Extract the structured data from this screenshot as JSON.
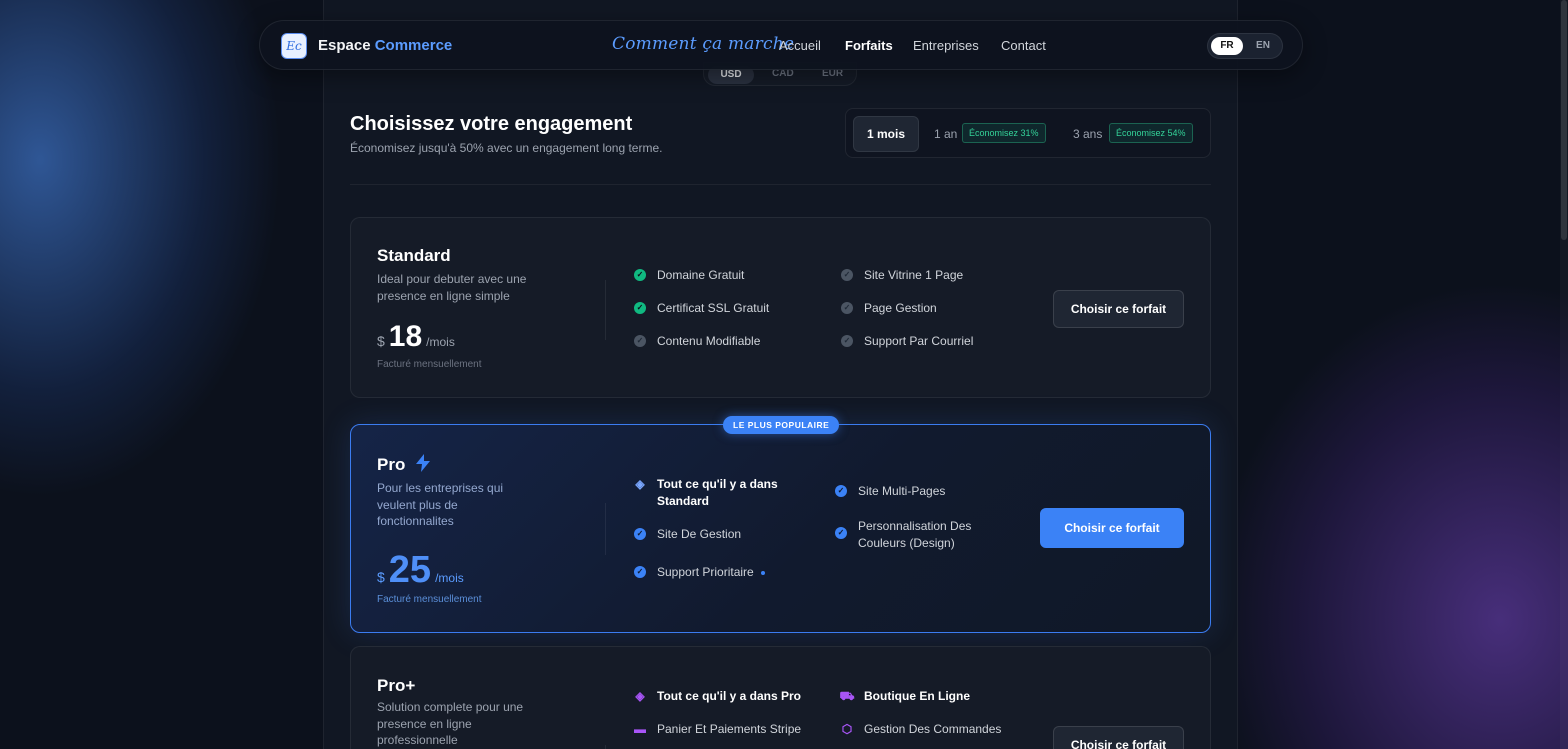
{
  "navbar": {
    "logo_text": "Ec",
    "brand_primary": "Espace",
    "brand_accent": "Commerce",
    "how_it_works": "Comment ça marche",
    "links": [
      "Accueil",
      "Forfaits",
      "Entreprises",
      "Contact"
    ],
    "active_link": "Forfaits",
    "lang": {
      "fr": "FR",
      "en": "EN",
      "selected": "FR"
    }
  },
  "currency": {
    "options": [
      "USD",
      "CAD",
      "EUR"
    ],
    "selected": "USD"
  },
  "commitment": {
    "title": "Choisissez votre engagement",
    "subtitle": "Économisez jusqu'à 50% avec un engagement long terme.",
    "options": [
      {
        "label": "1 mois",
        "save": ""
      },
      {
        "label": "1 an",
        "save": "Économisez 31%"
      },
      {
        "label": "3 ans",
        "save": "Économisez 54%"
      }
    ],
    "selected": "1 mois"
  },
  "plans": [
    {
      "name": "Standard",
      "desc": "Ideal pour debuter avec une presence en ligne simple",
      "currency": "$",
      "price": "18",
      "period": "/mois",
      "billed": "Facturé mensuellement",
      "features_left": [
        "Domaine Gratuit",
        "Certificat SSL Gratuit",
        "Contenu Modifiable"
      ],
      "features_right": [
        "Site Vitrine 1 Page",
        "Page Gestion",
        "Support Par Courriel"
      ],
      "cta": "Choisir ce forfait"
    },
    {
      "name": "Pro",
      "badge": "LE PLUS POPULAIRE",
      "desc": "Pour les entreprises qui veulent plus de fonctionnalites",
      "currency": "$",
      "price": "25",
      "period": "/mois",
      "billed": "Facturé mensuellement",
      "features_left": [
        "Tout ce qu'il y a dans Standard",
        "Site De Gestion",
        "Support Prioritaire"
      ],
      "features_right": [
        "Site Multi-Pages",
        "Personnalisation Des Couleurs (Design)"
      ],
      "cta": "Choisir ce forfait"
    },
    {
      "name": "Pro+",
      "desc": "Solution complete pour une presence en ligne professionnelle",
      "features_left": [
        "Tout ce qu'il y a dans Pro",
        "Panier Et Paiements Stripe"
      ],
      "features_right": [
        "Boutique En Ligne",
        "Gestion Des Commandes"
      ],
      "cta": "Choisir ce forfait"
    }
  ],
  "colors": {
    "accent": "#3b82f6",
    "success": "#10b981",
    "proplus": "#a855f7",
    "background": "#0b0f19"
  }
}
